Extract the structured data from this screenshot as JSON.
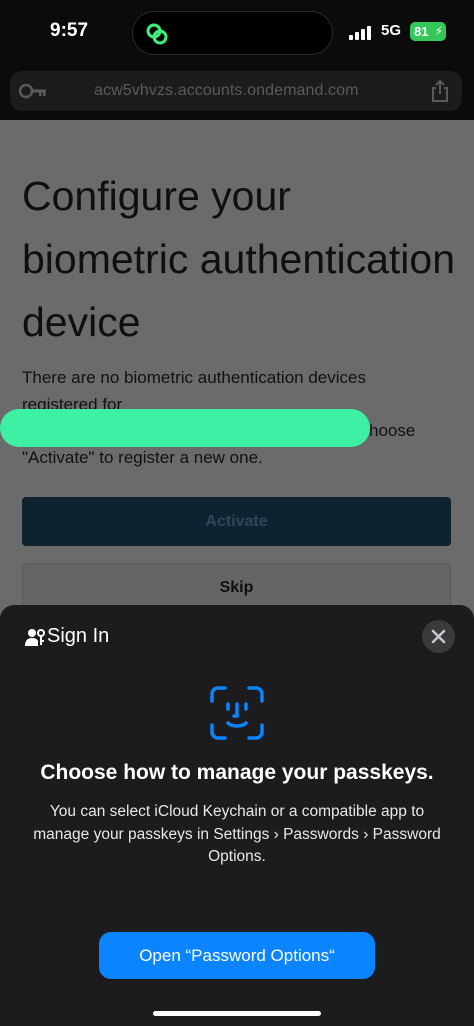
{
  "status_bar": {
    "time": "9:57",
    "network": "5G",
    "battery": "81"
  },
  "browser": {
    "url": "acw5vhvzs.accounts.ondemand.com"
  },
  "page": {
    "title": "Configure your biometric authentication device",
    "description_part1": "There are no biometric authentication devices registered for",
    "description_part2": "Choose \"Activate\" to register a new one.",
    "activate_label": "Activate",
    "skip_label": "Skip",
    "redaction_color": "#3ef0a5"
  },
  "sheet": {
    "title": "Sign In",
    "heading": "Choose how to manage your passkeys.",
    "body": "You can select iCloud Keychain or a compatible app to manage your passkeys in Settings › Passwords › Password Options.",
    "primary_button": "Open “Password Options“",
    "accent_color": "#0a84ff"
  }
}
